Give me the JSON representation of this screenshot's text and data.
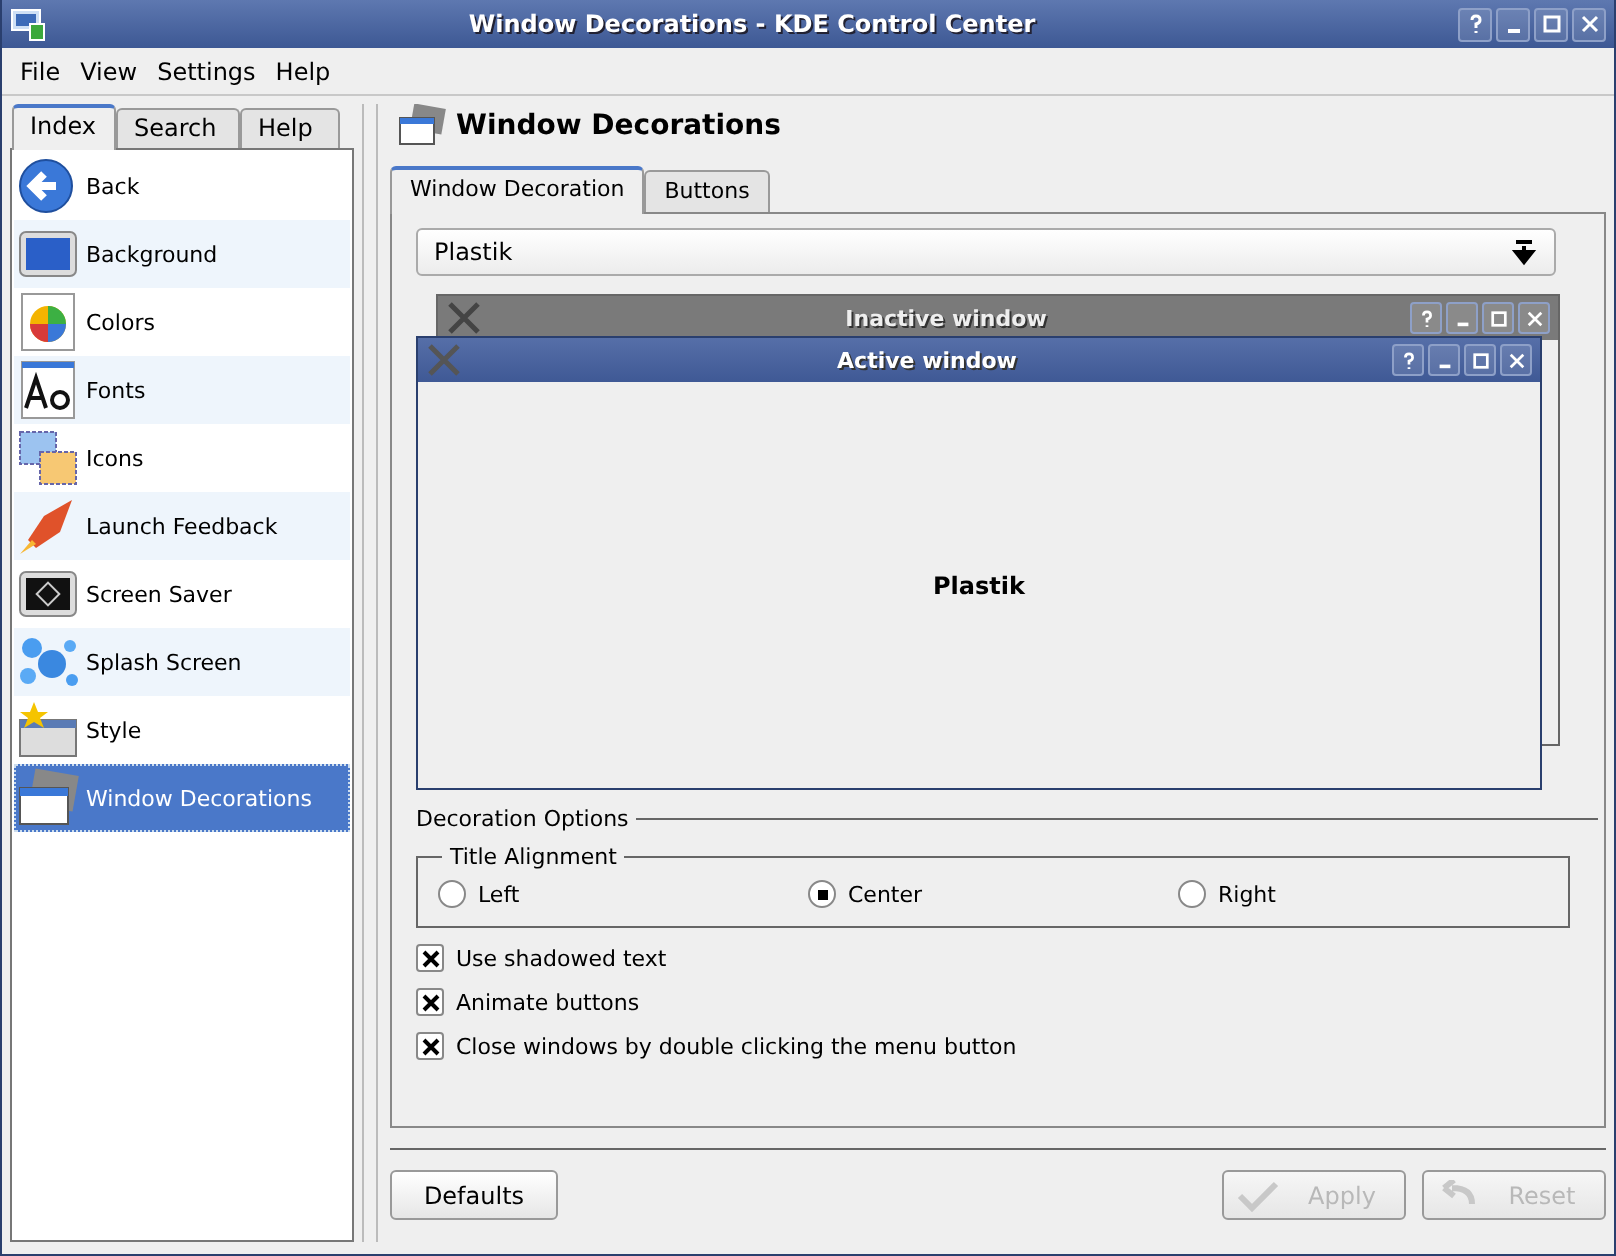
{
  "window": {
    "title": "Window Decorations - KDE Control Center"
  },
  "menu": [
    "File",
    "View",
    "Settings",
    "Help"
  ],
  "sidebar": {
    "tabs": [
      {
        "label": "Index",
        "selected": true
      },
      {
        "label": "Search",
        "selected": false
      },
      {
        "label": "Help",
        "selected": false
      }
    ],
    "items": [
      {
        "label": "Back",
        "selected": false
      },
      {
        "label": "Background",
        "selected": false
      },
      {
        "label": "Colors",
        "selected": false
      },
      {
        "label": "Fonts",
        "selected": false
      },
      {
        "label": "Icons",
        "selected": false
      },
      {
        "label": "Launch Feedback",
        "selected": false
      },
      {
        "label": "Screen Saver",
        "selected": false
      },
      {
        "label": "Splash Screen",
        "selected": false
      },
      {
        "label": "Style",
        "selected": false
      },
      {
        "label": "Window Decorations",
        "selected": true
      }
    ]
  },
  "page": {
    "title": "Window Decorations",
    "tabs": [
      {
        "label": "Window Decoration",
        "selected": true
      },
      {
        "label": "Buttons",
        "selected": false
      }
    ],
    "decoration": {
      "value": "Plastik"
    },
    "preview": {
      "inactive_title": "Inactive window",
      "active_title": "Active window",
      "label": "Plastik"
    },
    "options": {
      "title": "Decoration Options",
      "alignment": {
        "title": "Title Alignment",
        "choices": [
          {
            "label": "Left",
            "selected": false
          },
          {
            "label": "Center",
            "selected": true
          },
          {
            "label": "Right",
            "selected": false
          }
        ]
      },
      "checkboxes": [
        {
          "label": "Use shadowed text",
          "checked": true
        },
        {
          "label": "Animate buttons",
          "checked": true
        },
        {
          "label": "Close windows by double clicking the menu button",
          "checked": true
        }
      ]
    }
  },
  "buttons": [
    {
      "label": "Defaults",
      "disabled": false
    },
    {
      "label": "Apply",
      "disabled": true
    },
    {
      "label": "Reset",
      "disabled": true
    }
  ]
}
